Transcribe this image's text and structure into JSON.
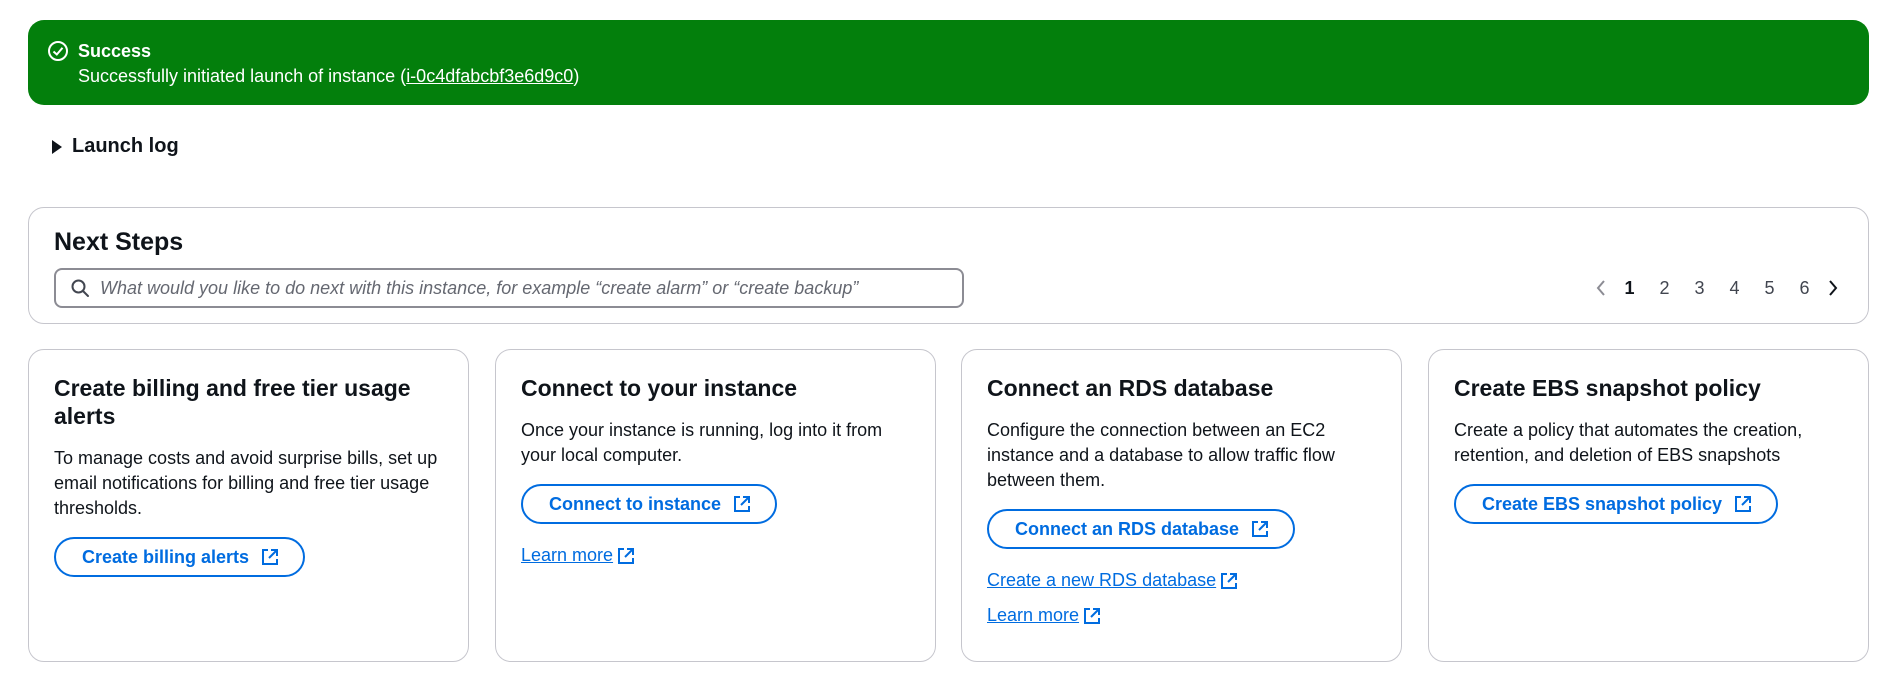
{
  "flash": {
    "title": "Success",
    "message_prefix": "Successfully initiated launch of instance (",
    "instance_id": "i-0c4dfabcbf3e6d9c0",
    "message_suffix": ")",
    "color": "#037f0c"
  },
  "launch_log": {
    "label": "Launch log"
  },
  "next_steps": {
    "title": "Next Steps",
    "search_placeholder": "What would you like to do next with this instance, for example “create alarm” or “create backup”",
    "search_value": "",
    "pagination": {
      "pages": [
        "1",
        "2",
        "3",
        "4",
        "5",
        "6"
      ],
      "current": "1"
    }
  },
  "cards": [
    {
      "title": "Create billing and free tier usage alerts",
      "description": "To manage costs and avoid surprise bills, set up email notifications for billing and free tier usage thresholds.",
      "button": "Create billing alerts"
    },
    {
      "title": "Connect to your instance",
      "description": "Once your instance is running, log into it from your local computer.",
      "button": "Connect to instance",
      "link1": "Learn more"
    },
    {
      "title": "Connect an RDS database",
      "description": "Configure the connection between an EC2 instance and a database to allow traffic flow between them.",
      "button": "Connect an RDS database",
      "link1": "Create a new RDS database",
      "link2": "Learn more"
    },
    {
      "title": "Create EBS snapshot policy",
      "description": "Create a policy that automates the creation, retention, and deletion of EBS snapshots",
      "button": "Create EBS snapshot policy"
    }
  ],
  "colors": {
    "accent": "#006ce0",
    "border": "#c6c6cd",
    "success": "#037f0c"
  }
}
